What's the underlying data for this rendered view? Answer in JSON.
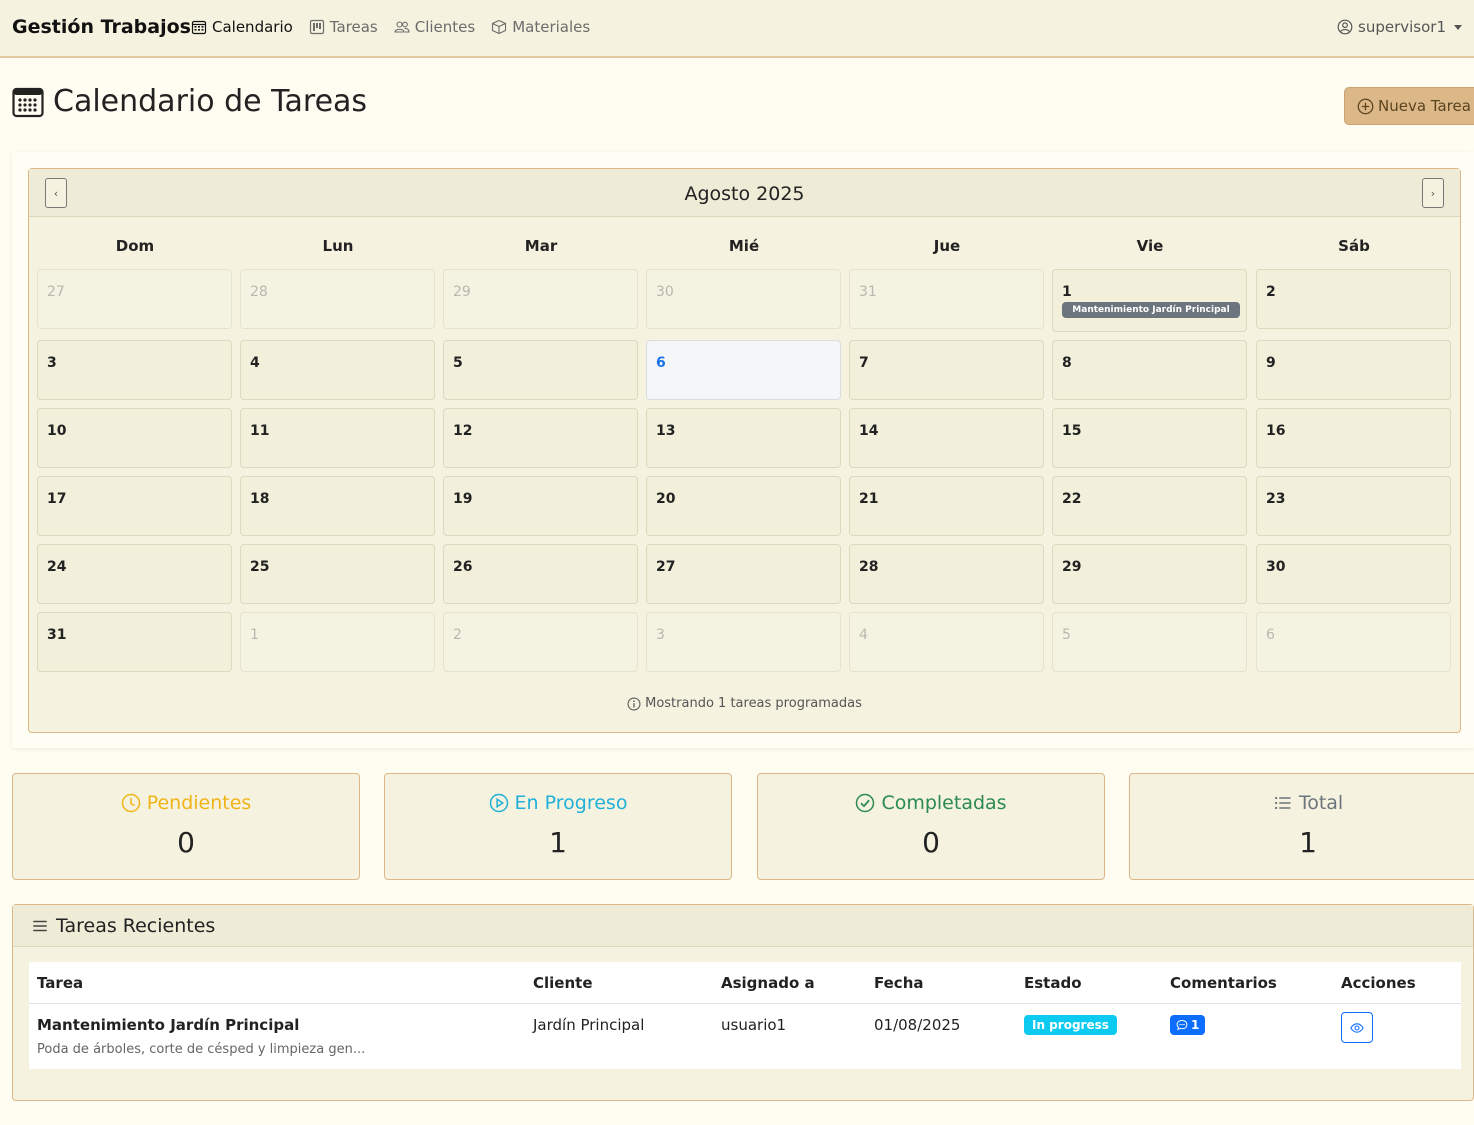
{
  "nav": {
    "brand": "Gestión Trabajos",
    "links": [
      {
        "label": "Calendario",
        "icon": "calendar-icon"
      },
      {
        "label": "Tareas",
        "icon": "kanban-icon"
      },
      {
        "label": "Clientes",
        "icon": "people-icon"
      },
      {
        "label": "Materiales",
        "icon": "box-icon"
      }
    ],
    "user": "supervisor1"
  },
  "header": {
    "title": "Calendario de Tareas",
    "new_button": "Nueva Tarea"
  },
  "calendar": {
    "month_title": "Agosto 2025",
    "prev": "‹",
    "next": "›",
    "weekdays": [
      "Dom",
      "Lun",
      "Mar",
      "Mié",
      "Jue",
      "Vie",
      "Sáb"
    ],
    "days": [
      {
        "n": "27",
        "other": true
      },
      {
        "n": "28",
        "other": true
      },
      {
        "n": "29",
        "other": true
      },
      {
        "n": "30",
        "other": true
      },
      {
        "n": "31",
        "other": true
      },
      {
        "n": "1",
        "event": "Mantenimiento Jardín Principal"
      },
      {
        "n": "2"
      },
      {
        "n": "3"
      },
      {
        "n": "4"
      },
      {
        "n": "5"
      },
      {
        "n": "6",
        "today": true
      },
      {
        "n": "7"
      },
      {
        "n": "8"
      },
      {
        "n": "9"
      },
      {
        "n": "10"
      },
      {
        "n": "11"
      },
      {
        "n": "12"
      },
      {
        "n": "13"
      },
      {
        "n": "14"
      },
      {
        "n": "15"
      },
      {
        "n": "16"
      },
      {
        "n": "17"
      },
      {
        "n": "18"
      },
      {
        "n": "19"
      },
      {
        "n": "20"
      },
      {
        "n": "21"
      },
      {
        "n": "22"
      },
      {
        "n": "23"
      },
      {
        "n": "24"
      },
      {
        "n": "25"
      },
      {
        "n": "26"
      },
      {
        "n": "27"
      },
      {
        "n": "28"
      },
      {
        "n": "29"
      },
      {
        "n": "30"
      },
      {
        "n": "31"
      },
      {
        "n": "1",
        "other": true
      },
      {
        "n": "2",
        "other": true
      },
      {
        "n": "3",
        "other": true
      },
      {
        "n": "4",
        "other": true
      },
      {
        "n": "5",
        "other": true
      },
      {
        "n": "6",
        "other": true
      }
    ],
    "info": "Mostrando 1 tareas programadas"
  },
  "stats": [
    {
      "label": "Pendientes",
      "value": "0",
      "color": "#f0b418",
      "icon": "clock-icon"
    },
    {
      "label": "En Progreso",
      "value": "1",
      "color": "#20b0d8",
      "icon": "play-circle-icon"
    },
    {
      "label": "Completadas",
      "value": "0",
      "color": "#2a8a4f",
      "icon": "check-circle-icon"
    },
    {
      "label": "Total",
      "value": "1",
      "color": "#6c757d",
      "icon": "list-icon"
    }
  ],
  "recent": {
    "title": "Tareas Recientes",
    "columns": [
      "Tarea",
      "Cliente",
      "Asignado a",
      "Fecha",
      "Estado",
      "Comentarios",
      "Acciones"
    ],
    "rows": [
      {
        "task": "Mantenimiento Jardín Principal",
        "desc": "Poda de árboles, corte de césped y limpieza gen...",
        "client": "Jardín Principal",
        "assigned": "usuario1",
        "date": "01/08/2025",
        "status": "In progress",
        "comments": "1"
      }
    ]
  }
}
